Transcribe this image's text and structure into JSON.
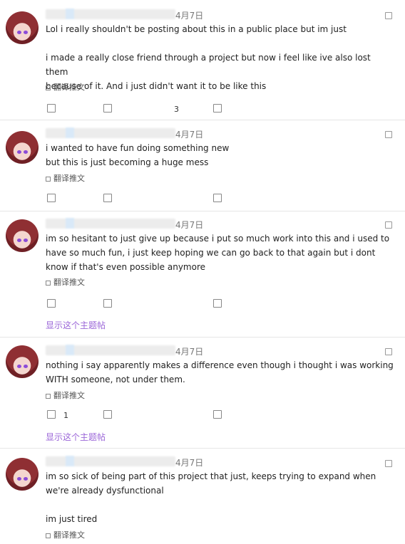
{
  "tweets": [
    {
      "date": "4月7日",
      "body": "Lol i really shouldn't be posting about this in a public place but im just\n\ni made a really close friend through a project but now i feel like ive also lost them\nbecause of it. And i just didn't want it to be like this",
      "translate": "翻译推文",
      "retweet_count": "3"
    },
    {
      "date": "4月7日",
      "body": "i wanted to have fun doing something new\nbut this is just becoming a huge mess",
      "translate": "翻译推文"
    },
    {
      "date": "4月7日",
      "body": "im so hesitant to just give up because i put so much work into this and i used to\nhave so much fun, i just keep hoping we can go back to that again but i dont\nknow if that's even possible anymore",
      "translate": "翻译推文",
      "show_thread": "显示这个主题帖"
    },
    {
      "date": "4月7日",
      "body": "nothing i say apparently makes a difference even though i thought i was working\nWITH someone, not under them.",
      "translate": "翻译推文",
      "reply_count": "1",
      "show_thread": "显示这个主题帖"
    },
    {
      "date": "4月7日",
      "body": "im so sick of being part of this project that just, keeps trying to expand when\nwe're already dysfunctional\n\nim just tired",
      "translate": "翻译推文"
    }
  ]
}
